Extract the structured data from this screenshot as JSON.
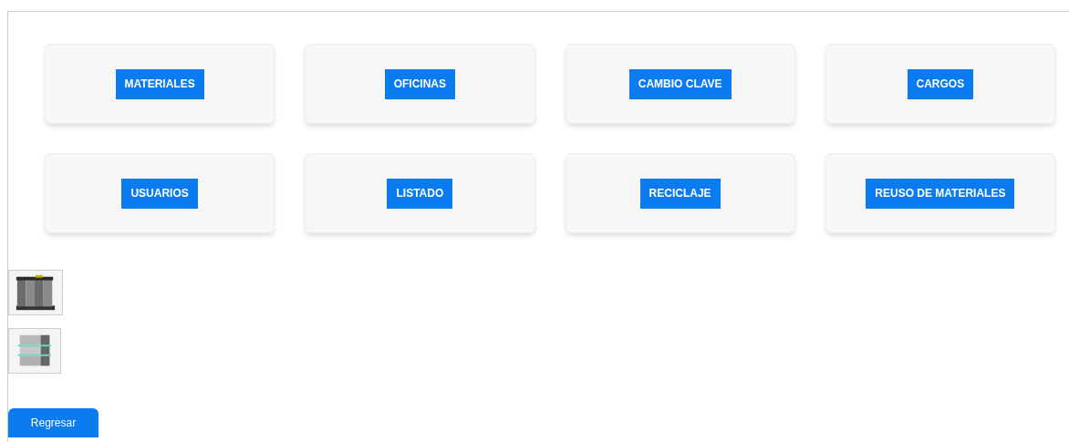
{
  "menu_cards": [
    {
      "label": "MATERIALES"
    },
    {
      "label": "OFICINAS"
    },
    {
      "label": "CAMBIO CLAVE"
    },
    {
      "label": "CARGOS"
    },
    {
      "label": "USUARIOS"
    },
    {
      "label": "LISTADO"
    },
    {
      "label": "RECICLAJE"
    },
    {
      "label": "REUSO DE MATERIALES"
    }
  ],
  "back_button": {
    "label": "Regresar"
  }
}
